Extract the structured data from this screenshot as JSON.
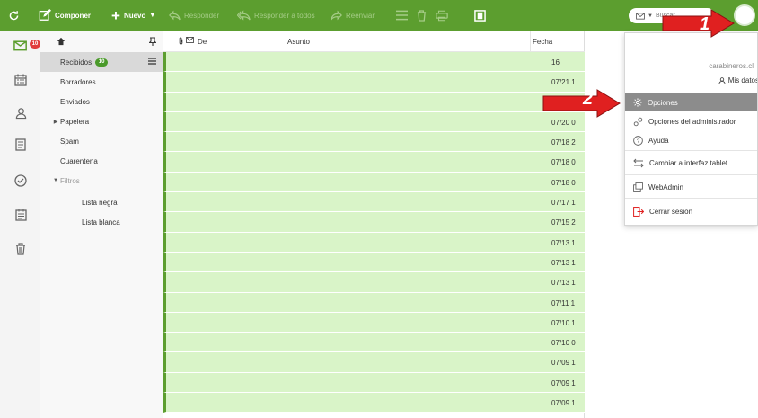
{
  "toolbar": {
    "compose_label": "Componer",
    "new_label": "Nuevo",
    "reply_label": "Responder",
    "reply_all_label": "Responder a todos",
    "forward_label": "Reenviar",
    "search_placeholder": "Buscar"
  },
  "rail": {
    "mail_badge": "10"
  },
  "folders": {
    "items": [
      {
        "label": "Recibidos",
        "badge": "10"
      },
      {
        "label": "Borradores"
      },
      {
        "label": "Enviados"
      },
      {
        "label": "Papelera"
      },
      {
        "label": "Spam"
      },
      {
        "label": "Cuarentena"
      },
      {
        "label": "Filtros"
      },
      {
        "label": "Lista negra"
      },
      {
        "label": "Lista blanca"
      }
    ]
  },
  "list": {
    "headers": {
      "from": "De",
      "subject": "Asunto",
      "date": "Fecha"
    },
    "rows": [
      {
        "date": "16"
      },
      {
        "date": "07/21 1"
      },
      {
        "date": ""
      },
      {
        "date": "07/20 0"
      },
      {
        "date": "07/18 2"
      },
      {
        "date": "07/18 0"
      },
      {
        "date": "07/18 0"
      },
      {
        "date": "07/17 1"
      },
      {
        "date": "07/15 2"
      },
      {
        "date": "07/13 1"
      },
      {
        "date": "07/13 1"
      },
      {
        "date": "07/13 1"
      },
      {
        "date": "07/11 1"
      },
      {
        "date": "07/10 1"
      },
      {
        "date": "07/10 0"
      },
      {
        "date": "07/09 1"
      },
      {
        "date": "07/09 1"
      },
      {
        "date": "07/09 1"
      }
    ]
  },
  "menu": {
    "domain": "carabineros.cl",
    "my_data": "Mis datos",
    "items": [
      {
        "label": "Opciones"
      },
      {
        "label": "Opciones del administrador"
      },
      {
        "label": "Ayuda"
      },
      {
        "label": "Cambiar a interfaz tablet"
      },
      {
        "label": "WebAdmin"
      },
      {
        "label": "Cerrar sesión"
      }
    ]
  },
  "annotations": {
    "step1": "1",
    "step2": "2"
  },
  "colors": {
    "toolbar_green": "#5c9e2f",
    "row_green": "#d9f4c8",
    "badge_red": "#e13d3d",
    "arrow_red": "#e02020",
    "menu_active": "#8c8c8c"
  }
}
